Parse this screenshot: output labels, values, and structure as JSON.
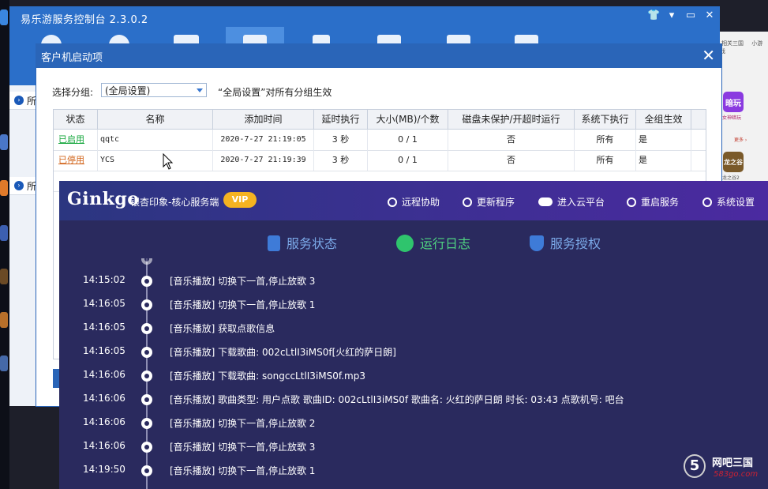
{
  "main_window": {
    "title": "易乐游服务控制台 2.3.0.2",
    "controls": [
      "👕",
      "▾",
      "▭",
      "✕"
    ]
  },
  "left_panel": {
    "rows": [
      "所",
      "所"
    ]
  },
  "dialog": {
    "title": "客户机启动项",
    "close": "✕",
    "group_label": "选择分组:",
    "group_value": "(全局设置)",
    "group_note": "“全局设置”对所有分组生效",
    "columns": [
      "状态",
      "名称",
      "添加时间",
      "延时执行",
      "大小(MB)/个数",
      "磁盘未保护/开超时运行",
      "系统下执行",
      "全组生效"
    ],
    "rows": [
      {
        "status": "已启用",
        "status_kind": "on",
        "name": "qqtc",
        "time": "2020-7-27 21:19:05",
        "delay": "3 秒",
        "size": "0 / 1",
        "disk": "否",
        "sys": "所有",
        "all": "是"
      },
      {
        "status": "已停用",
        "status_kind": "off",
        "name": "YCS",
        "time": "2020-7-27 21:19:39",
        "delay": "3 秒",
        "size": "0 / 1",
        "disk": "否",
        "sys": "所有",
        "all": "是"
      }
    ]
  },
  "right_strip": {
    "top_links": [
      "相关三国",
      "小游戏"
    ],
    "apps": [
      {
        "label": "暗玩",
        "caption": "女神暗玩",
        "color": "#8a3ae0"
      },
      {
        "label": "龙之谷",
        "caption": "龙之谷2",
        "color": "#7a5a2a"
      }
    ],
    "more": "更多 ›"
  },
  "ginkgo": {
    "logo": "Ginkgo",
    "subtitle": "银杏印象-核心服务端",
    "vip": "VIP",
    "actions": [
      "远程协助",
      "更新程序",
      "进入云平台",
      "重启服务",
      "系统设置"
    ],
    "tabs": [
      "服务状态",
      "运行日志",
      "服务授权"
    ],
    "active_tab": 1,
    "log": [
      {
        "time": "14:15:02",
        "msg": "[音乐播放] 切换下一首,停止放歌 3"
      },
      {
        "time": "14:16:05",
        "msg": "[音乐播放] 切换下一首,停止放歌 1"
      },
      {
        "time": "14:16:05",
        "msg": "[音乐播放] 获取点歌信息"
      },
      {
        "time": "14:16:05",
        "msg": "[音乐播放] 下载歌曲: 002cLtlI3iMS0f[火红的萨日朗]"
      },
      {
        "time": "14:16:06",
        "msg": "[音乐播放] 下载歌曲: songccLtlI3iMS0f.mp3"
      },
      {
        "time": "14:16:06",
        "msg": "[音乐播放] 歌曲类型: 用户点歌 歌曲ID: 002cLtlI3iMS0f 歌曲名: 火红的萨日朗 时长: 03:43 点歌机号: 吧台"
      },
      {
        "time": "14:16:06",
        "msg": "[音乐播放] 切换下一首,停止放歌 2"
      },
      {
        "time": "14:16:06",
        "msg": "[音乐播放] 切换下一首,停止放歌 3"
      },
      {
        "time": "14:19:50",
        "msg": "[音乐播放] 切换下一首,停止放歌 1"
      }
    ]
  },
  "watermark": {
    "mark": "5",
    "name": "网吧三国",
    "site": "583go.com"
  },
  "colors": {
    "title_blue": "#2b6fc9",
    "enabled_green": "#12a63a",
    "disabled_orange": "#d2641a",
    "ginkgo_bg": "#2a2a5e",
    "vip_gold": "#f5b321"
  }
}
